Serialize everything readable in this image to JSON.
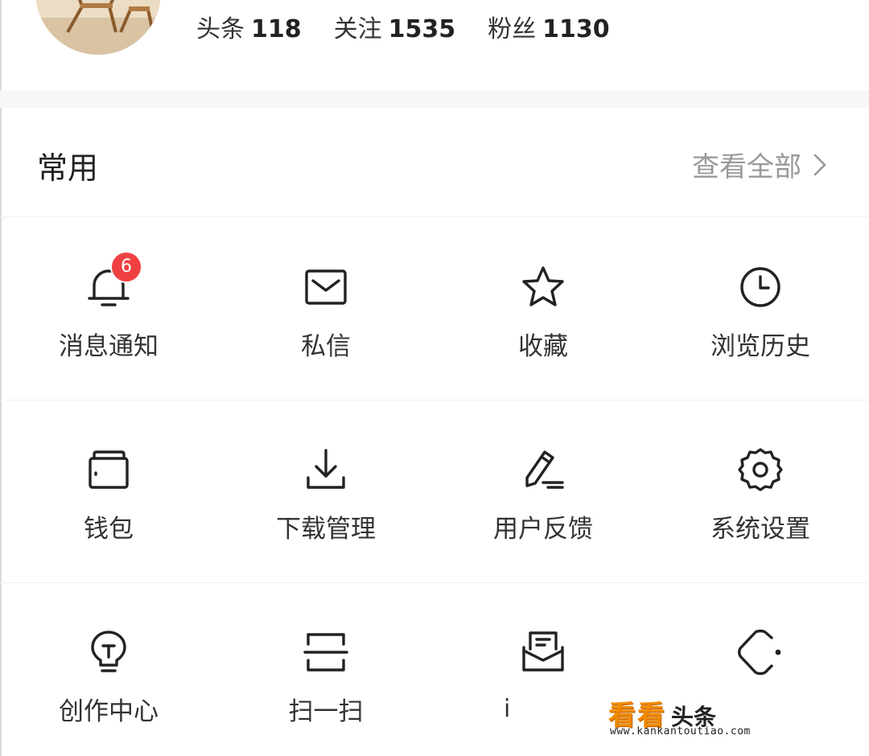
{
  "profile": {
    "stats": [
      {
        "label": "头条",
        "value": "118"
      },
      {
        "label": "关注",
        "value": "1535"
      },
      {
        "label": "粉丝",
        "value": "1130"
      }
    ]
  },
  "section": {
    "title": "常用",
    "view_all": "查看全部"
  },
  "grid": {
    "items": [
      {
        "label": "消息通知",
        "icon": "bell-icon",
        "badge": "6"
      },
      {
        "label": "私信",
        "icon": "mail-icon"
      },
      {
        "label": "收藏",
        "icon": "star-icon"
      },
      {
        "label": "浏览历史",
        "icon": "clock-icon"
      },
      {
        "label": "钱包",
        "icon": "wallet-icon"
      },
      {
        "label": "下载管理",
        "icon": "download-icon"
      },
      {
        "label": "用户反馈",
        "icon": "pencil-icon"
      },
      {
        "label": "系统设置",
        "icon": "gear-icon"
      },
      {
        "label": "创作中心",
        "icon": "lightbulb-icon"
      },
      {
        "label": "扫一扫",
        "icon": "scan-icon"
      },
      {
        "label": "",
        "icon": "inbox-icon"
      },
      {
        "label": "",
        "icon": "shape-icon"
      }
    ]
  },
  "watermark": {
    "stub": "i",
    "brand_orange": "看看",
    "brand_black": "头条",
    "url": "www.kankantoutiao.com"
  },
  "colors": {
    "badge": "#f04142",
    "watermark_orange": "#f08a00",
    "secondary_text": "#999999"
  }
}
